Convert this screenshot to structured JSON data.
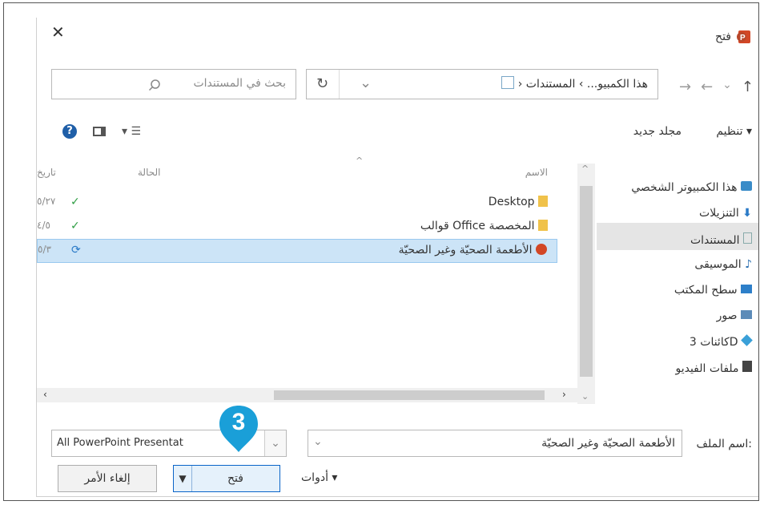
{
  "titlebar": {
    "title": "فتح",
    "close_glyph": "✕"
  },
  "address": {
    "path_root": "هذا الكمبيو...",
    "path_sep1": "›",
    "path_folder": "المستندات",
    "path_sep2": "›",
    "search_placeholder": "بحث في المستندات",
    "refresh_glyph": "↻",
    "dropdown_glyph": "⌄"
  },
  "toolbar": {
    "organize": "تنظيم ▾",
    "new_folder": "مجلد جديد"
  },
  "nav_pane": {
    "items": [
      {
        "label": "هذا الكمبيوتر الشخصي",
        "icon": "computer-icon"
      },
      {
        "label": "التنزيلات",
        "icon": "downloads-icon"
      },
      {
        "label": "المستندات",
        "icon": "documents-icon"
      },
      {
        "label": "الموسيقى",
        "icon": "music-icon"
      },
      {
        "label": "سطح المكتب",
        "icon": "desktop-icon"
      },
      {
        "label": "صور",
        "icon": "pictures-icon"
      },
      {
        "label": "كائنات 3D",
        "icon": "objects-3d-icon"
      },
      {
        "label": "ملفات الفيديو",
        "icon": "videos-icon"
      }
    ],
    "selected_index": 2
  },
  "file_list": {
    "columns": {
      "name": "الاسم",
      "status": "الحالة",
      "date": "تاريخ"
    },
    "rows": [
      {
        "name": "Desktop",
        "icon": "folder-icon",
        "status_icon": "synced-icon",
        "date": "٥/٢٧"
      },
      {
        "name": "قوالب Office المخصصة",
        "icon": "folder-icon",
        "status_icon": "synced-icon",
        "date": "٤/٥"
      },
      {
        "name": "الأطعمة الصحيّة وغير الصحيّة",
        "icon": "powerpoint-file-icon",
        "status_icon": "syncing-icon",
        "date": "٥/٣"
      }
    ],
    "selected_index": 2
  },
  "bottom": {
    "filename_label": "اسم الملف:",
    "filename_value": "الأطعمة الصحيّة وغير الصحيّة",
    "filetype_value": "All PowerPoint Presentat",
    "tools_label": "أدوات",
    "open_label": "فتح",
    "cancel_label": "إلغاء الأمر"
  },
  "callout": {
    "number": "3",
    "color": "#1a9fd8"
  },
  "colors": {
    "selection": "#cce4f7",
    "accent": "#1a9fd8",
    "ppt": "#d24726"
  }
}
